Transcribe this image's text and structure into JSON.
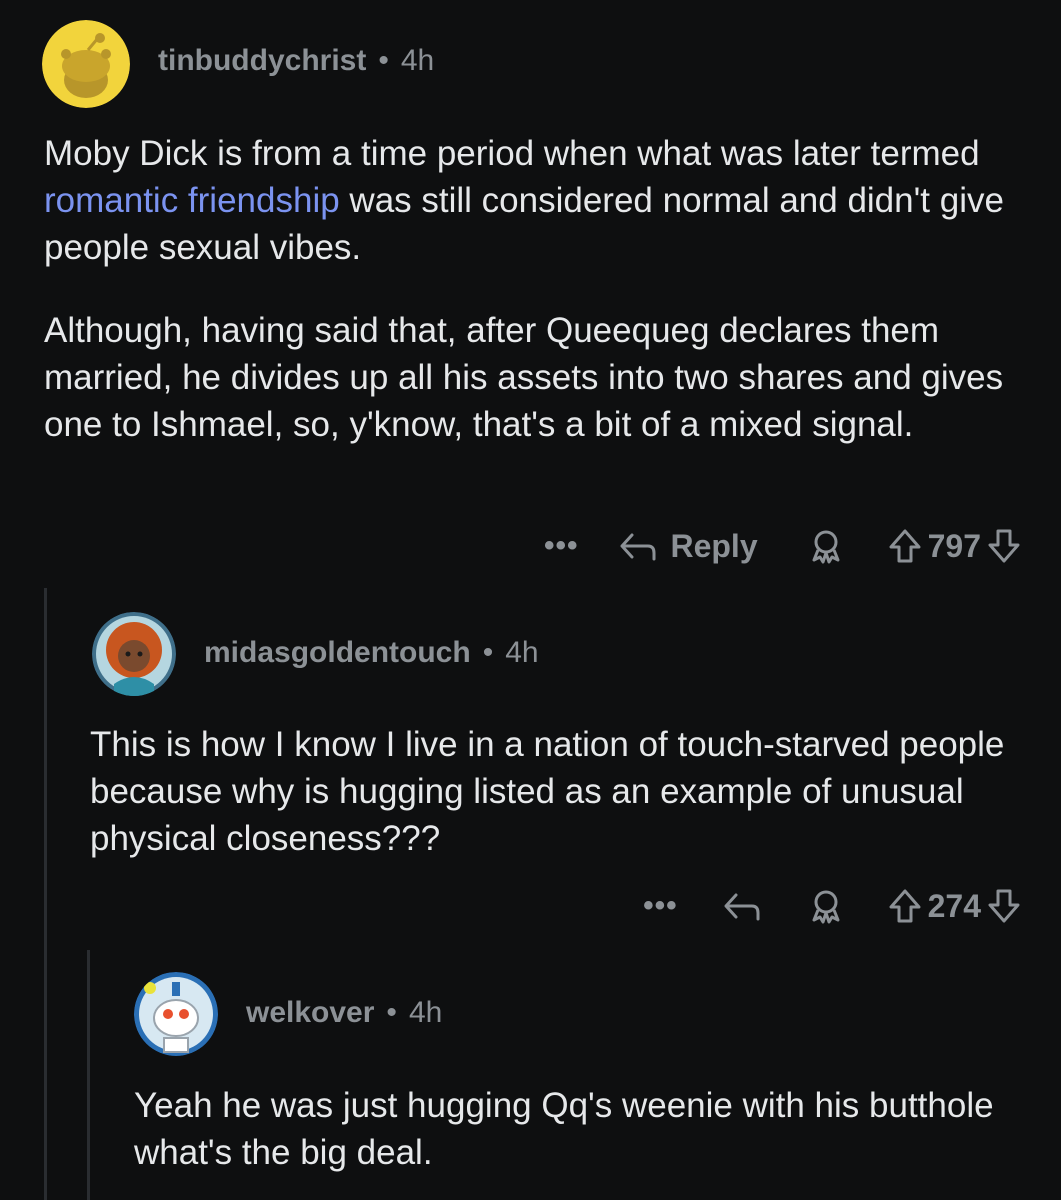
{
  "comments": [
    {
      "username": "tinbuddychrist",
      "separator": "•",
      "time": "4h",
      "body": {
        "p1_before": "Moby Dick is from a time period when what was later termed ",
        "p1_link": "romantic friendship",
        "p1_after": " was still considered normal and didn't give people sexual vibes.",
        "p2": "Although, having said that, after Queequeg declares them married, he divides up all his assets into two shares and gives one to Ishmael, so, y'know, that's a bit of a mixed signal."
      },
      "actions": {
        "more": "•••",
        "reply": "Reply",
        "score": "797"
      }
    },
    {
      "username": "midasgoldentouch",
      "separator": "•",
      "time": "4h",
      "body": {
        "p1": "This is how I know I live in a nation of touch-starved people because why is hugging listed as an example of unusual physical closeness???"
      },
      "actions": {
        "more": "•••",
        "score": "274"
      }
    },
    {
      "username": "welkover",
      "separator": "•",
      "time": "4h",
      "body": {
        "p1": "Yeah he was just hugging Qq's weenie with his butthole what's the big deal."
      }
    }
  ],
  "icons": {
    "more": "ellipsis-icon",
    "reply": "reply-arrow-icon",
    "award": "award-icon",
    "upvote": "upvote-arrow-icon",
    "downvote": "downvote-arrow-icon"
  },
  "colors": {
    "background": "#0e0f10",
    "text": "#e6e8ea",
    "muted": "#8c9196",
    "link": "#7b93f0",
    "thread_line": "#2a2d31"
  }
}
